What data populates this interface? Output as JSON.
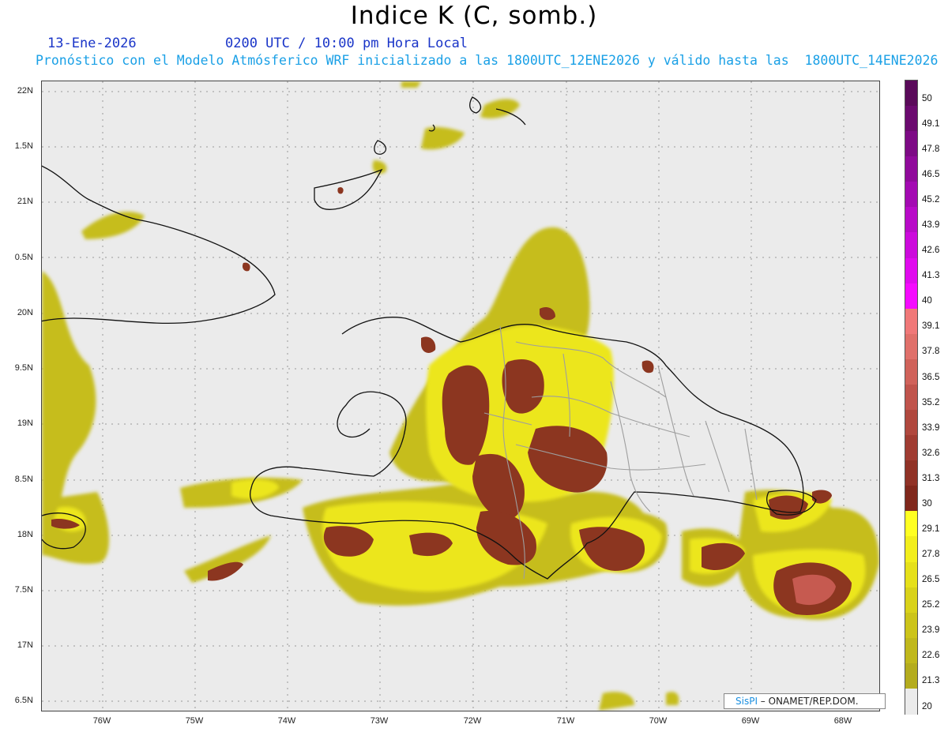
{
  "header": {
    "title": "Indice K (C, somb.)",
    "date": "13-Ene-2026",
    "time": "0200 UTC / 10:00 pm Hora Local",
    "subtitle": "Pronóstico con el Modelo Atmósferico WRF inicializado a las 1800UTC_12ENE2026 y válido hasta las  1800UTC_14ENE2026"
  },
  "axes": {
    "y_labels": [
      "22N",
      "1.5N",
      "21N",
      "0.5N",
      "20N",
      "9.5N",
      "19N",
      "8.5N",
      "18N",
      "7.5N",
      "17N",
      "6.5N"
    ],
    "x_labels": [
      "76W",
      "75W",
      "74W",
      "73W",
      "72W",
      "71W",
      "70W",
      "69W",
      "68W"
    ]
  },
  "colorbar": {
    "labels": [
      "50",
      "49.1",
      "47.8",
      "46.5",
      "45.2",
      "43.9",
      "42.6",
      "41.3",
      "40",
      "39.1",
      "37.8",
      "36.5",
      "35.2",
      "33.9",
      "32.6",
      "31.3",
      "30",
      "29.1",
      "27.8",
      "26.5",
      "25.2",
      "23.9",
      "22.6",
      "21.3",
      "20"
    ],
    "colors": [
      "#5a0a5a",
      "#6b0a6f",
      "#7d0a85",
      "#900a9b",
      "#a30ab2",
      "#b80ac8",
      "#cc0adc",
      "#e00aee",
      "#f50aff",
      "#f07878",
      "#e0706a",
      "#d0625a",
      "#c0544c",
      "#b0483e",
      "#a03c32",
      "#903226",
      "#80281c",
      "#ffff22",
      "#f2ee1c",
      "#e6e01a",
      "#d9d21a",
      "#ccc41a",
      "#c0b81c",
      "#b4ac1e",
      "#ebebeb"
    ]
  },
  "credit": {
    "brand": "SisPI",
    "org": " – ONAMET/REP.DOM."
  },
  "colors": {
    "land_outline": "#111111",
    "border": "#999999",
    "ocean": "#ebebeb",
    "k_low": "#c8bf1e",
    "k_mid": "#ecec22",
    "k_high": "#8a3420",
    "k_max": "#c85a50"
  }
}
